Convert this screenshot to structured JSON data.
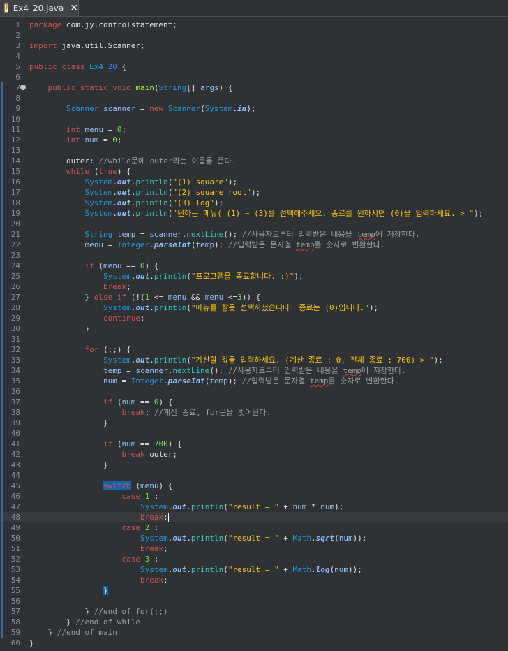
{
  "tab": {
    "filename": "Ex4_20.java",
    "close_glyph": "✕"
  },
  "lines": [
    {
      "n": 1,
      "t": [
        [
          "package",
          "kw"
        ],
        [
          " com.jy.controlstatement;",
          ""
        ]
      ]
    },
    {
      "n": 2,
      "t": []
    },
    {
      "n": 3,
      "t": [
        [
          "import",
          "kw"
        ],
        [
          " java.util.Scanner;",
          ""
        ]
      ]
    },
    {
      "n": 4,
      "t": []
    },
    {
      "n": 5,
      "t": [
        [
          "public",
          "kw"
        ],
        [
          " ",
          ""
        ],
        [
          "class",
          "kw"
        ],
        [
          " ",
          ""
        ],
        [
          "Ex4_20",
          "ty"
        ],
        [
          " {",
          ""
        ]
      ]
    },
    {
      "n": 6,
      "t": []
    },
    {
      "n": 7,
      "t": [
        [
          "    ",
          ""
        ],
        [
          "public",
          "kw"
        ],
        [
          " ",
          ""
        ],
        [
          "static",
          "kw"
        ],
        [
          " ",
          ""
        ],
        [
          "void",
          "kw"
        ],
        [
          " ",
          ""
        ],
        [
          "main",
          "fn"
        ],
        [
          "(",
          ""
        ],
        [
          "String",
          "ty"
        ],
        [
          "[] ",
          ""
        ],
        [
          "args",
          "sf"
        ],
        [
          ") {",
          ""
        ]
      ]
    },
    {
      "n": 8,
      "t": []
    },
    {
      "n": 9,
      "t": [
        [
          "        ",
          ""
        ],
        [
          "Scanner",
          "ty"
        ],
        [
          " ",
          ""
        ],
        [
          "scanner",
          "sf"
        ],
        [
          " = ",
          ""
        ],
        [
          "new",
          "kw"
        ],
        [
          " ",
          ""
        ],
        [
          "Scanner",
          "ty"
        ],
        [
          "(",
          ""
        ],
        [
          "System",
          "ty"
        ],
        [
          ".",
          ""
        ],
        [
          "in",
          "sm"
        ],
        [
          ");",
          ""
        ]
      ]
    },
    {
      "n": 10,
      "t": []
    },
    {
      "n": 11,
      "t": [
        [
          "        ",
          ""
        ],
        [
          "int",
          "kw"
        ],
        [
          " ",
          ""
        ],
        [
          "menu",
          "sf"
        ],
        [
          " = ",
          ""
        ],
        [
          "0",
          "nm"
        ],
        [
          ";",
          ""
        ]
      ]
    },
    {
      "n": 12,
      "t": [
        [
          "        ",
          ""
        ],
        [
          "int",
          "kw"
        ],
        [
          " ",
          ""
        ],
        [
          "num",
          "sf"
        ],
        [
          " = ",
          ""
        ],
        [
          "0",
          "nm"
        ],
        [
          ";",
          ""
        ]
      ]
    },
    {
      "n": 13,
      "t": []
    },
    {
      "n": 14,
      "t": [
        [
          "        outer: ",
          ""
        ],
        [
          "//while문에 outer라는 이름을 준다.",
          "cm"
        ]
      ]
    },
    {
      "n": 15,
      "t": [
        [
          "        ",
          ""
        ],
        [
          "while",
          "kw"
        ],
        [
          " (",
          ""
        ],
        [
          "true",
          "kw"
        ],
        [
          ") {",
          ""
        ]
      ]
    },
    {
      "n": 16,
      "t": [
        [
          "            ",
          ""
        ],
        [
          "System",
          "ty"
        ],
        [
          ".",
          ""
        ],
        [
          "out",
          "sm"
        ],
        [
          ".",
          ""
        ],
        [
          "println",
          "mc"
        ],
        [
          "(",
          ""
        ],
        [
          "\"(1) square\"",
          "st"
        ],
        [
          ");",
          ""
        ]
      ]
    },
    {
      "n": 17,
      "t": [
        [
          "            ",
          ""
        ],
        [
          "System",
          "ty"
        ],
        [
          ".",
          ""
        ],
        [
          "out",
          "sm"
        ],
        [
          ".",
          ""
        ],
        [
          "println",
          "mc"
        ],
        [
          "(",
          ""
        ],
        [
          "\"(2) square root\"",
          "st"
        ],
        [
          ");",
          ""
        ]
      ]
    },
    {
      "n": 18,
      "t": [
        [
          "            ",
          ""
        ],
        [
          "System",
          "ty"
        ],
        [
          ".",
          ""
        ],
        [
          "out",
          "sm"
        ],
        [
          ".",
          ""
        ],
        [
          "println",
          "mc"
        ],
        [
          "(",
          ""
        ],
        [
          "\"(3) log\"",
          "st"
        ],
        [
          ");",
          ""
        ]
      ]
    },
    {
      "n": 19,
      "t": [
        [
          "            ",
          ""
        ],
        [
          "System",
          "ty"
        ],
        [
          ".",
          ""
        ],
        [
          "out",
          "sm"
        ],
        [
          ".",
          ""
        ],
        [
          "println",
          "mc"
        ],
        [
          "(",
          ""
        ],
        [
          "\"원하는 메뉴( (1) ~ (3)를 선택해주세요. 종료를 원하시면 (0)을 입력하세요. > \"",
          "st"
        ],
        [
          ");",
          ""
        ]
      ]
    },
    {
      "n": 20,
      "t": []
    },
    {
      "n": 21,
      "t": [
        [
          "            ",
          ""
        ],
        [
          "String",
          "ty"
        ],
        [
          " ",
          ""
        ],
        [
          "temp",
          "sf"
        ],
        [
          " = ",
          ""
        ],
        [
          "scanner",
          "sf"
        ],
        [
          ".",
          ""
        ],
        [
          "nextLine",
          "mc"
        ],
        [
          "(); ",
          ""
        ],
        [
          "//사용자로부터 입력받은 내용을 ",
          "cm"
        ],
        [
          "temp",
          "cmt"
        ],
        [
          "에 저장한다.",
          "cm"
        ]
      ]
    },
    {
      "n": 22,
      "t": [
        [
          "            ",
          ""
        ],
        [
          "menu",
          "sf"
        ],
        [
          " = ",
          ""
        ],
        [
          "Integer",
          "ty"
        ],
        [
          ".",
          ""
        ],
        [
          "parseInt",
          "sm"
        ],
        [
          "(",
          ""
        ],
        [
          "temp",
          "sf"
        ],
        [
          "); ",
          ""
        ],
        [
          "//입력받은 문자열 ",
          "cm"
        ],
        [
          "temp",
          "cmt"
        ],
        [
          "를 숫자로 변환한다.",
          "cm"
        ]
      ]
    },
    {
      "n": 23,
      "t": []
    },
    {
      "n": 24,
      "t": [
        [
          "            ",
          ""
        ],
        [
          "if",
          "kw"
        ],
        [
          " (",
          ""
        ],
        [
          "menu",
          "sf"
        ],
        [
          " == ",
          ""
        ],
        [
          "0",
          "nm"
        ],
        [
          ") {",
          ""
        ]
      ]
    },
    {
      "n": 25,
      "t": [
        [
          "                ",
          ""
        ],
        [
          "System",
          "ty"
        ],
        [
          ".",
          ""
        ],
        [
          "out",
          "sm"
        ],
        [
          ".",
          ""
        ],
        [
          "println",
          "mc"
        ],
        [
          "(",
          ""
        ],
        [
          "\"프로그램을 종료합니다. :)\"",
          "st"
        ],
        [
          ");",
          ""
        ]
      ]
    },
    {
      "n": 26,
      "t": [
        [
          "                ",
          ""
        ],
        [
          "break",
          "kw"
        ],
        [
          ";",
          ""
        ]
      ]
    },
    {
      "n": 27,
      "t": [
        [
          "            } ",
          ""
        ],
        [
          "else",
          "kw"
        ],
        [
          " ",
          ""
        ],
        [
          "if",
          "kw"
        ],
        [
          " (!(",
          ""
        ],
        [
          "1",
          "nm"
        ],
        [
          " <= ",
          ""
        ],
        [
          "menu",
          "sf"
        ],
        [
          " && ",
          ""
        ],
        [
          "menu",
          "sf"
        ],
        [
          " <=",
          ""
        ],
        [
          "3",
          "nm"
        ],
        [
          ")) {",
          ""
        ]
      ]
    },
    {
      "n": 28,
      "t": [
        [
          "                ",
          ""
        ],
        [
          "System",
          "ty"
        ],
        [
          ".",
          ""
        ],
        [
          "out",
          "sm"
        ],
        [
          ".",
          ""
        ],
        [
          "println",
          "mc"
        ],
        [
          "(",
          ""
        ],
        [
          "\"메뉴를 잘못 선택하셨습니다! 종료는 (0)입니다.\"",
          "st"
        ],
        [
          ");",
          ""
        ]
      ]
    },
    {
      "n": 29,
      "t": [
        [
          "                ",
          ""
        ],
        [
          "continue",
          "kw"
        ],
        [
          ";",
          ""
        ]
      ]
    },
    {
      "n": 30,
      "t": [
        [
          "            }",
          ""
        ]
      ]
    },
    {
      "n": 31,
      "t": []
    },
    {
      "n": 32,
      "t": [
        [
          "            ",
          ""
        ],
        [
          "for",
          "kw"
        ],
        [
          " (;;) {",
          ""
        ]
      ]
    },
    {
      "n": 33,
      "t": [
        [
          "                ",
          ""
        ],
        [
          "System",
          "ty"
        ],
        [
          ".",
          ""
        ],
        [
          "out",
          "sm"
        ],
        [
          ".",
          ""
        ],
        [
          "println",
          "mc"
        ],
        [
          "(",
          ""
        ],
        [
          "\"계산할 값을 입력하세요. (계산 종료 : 0, 전체 종료 : 700) > \"",
          "st"
        ],
        [
          ");",
          ""
        ]
      ]
    },
    {
      "n": 34,
      "t": [
        [
          "                ",
          ""
        ],
        [
          "temp",
          "sf"
        ],
        [
          " = ",
          ""
        ],
        [
          "scanner",
          "sf"
        ],
        [
          ".",
          ""
        ],
        [
          "nextLine",
          "mc"
        ],
        [
          "(); ",
          ""
        ],
        [
          "//사용자로부터 입력받은 내용을 ",
          "cm"
        ],
        [
          "temp",
          "cmt"
        ],
        [
          "에 저장한다.",
          "cm"
        ]
      ]
    },
    {
      "n": 35,
      "t": [
        [
          "                ",
          ""
        ],
        [
          "num",
          "sf"
        ],
        [
          " = ",
          ""
        ],
        [
          "Integer",
          "ty"
        ],
        [
          ".",
          ""
        ],
        [
          "parseInt",
          "sm"
        ],
        [
          "(",
          ""
        ],
        [
          "temp",
          "sf"
        ],
        [
          "); ",
          ""
        ],
        [
          "//입력받은 문자열 ",
          "cm"
        ],
        [
          "temp",
          "cmt"
        ],
        [
          "를 숫자로 변환한다.",
          "cm"
        ]
      ]
    },
    {
      "n": 36,
      "t": []
    },
    {
      "n": 37,
      "t": [
        [
          "                ",
          ""
        ],
        [
          "if",
          "kw"
        ],
        [
          " (",
          ""
        ],
        [
          "num",
          "sf"
        ],
        [
          " == ",
          ""
        ],
        [
          "0",
          "nm"
        ],
        [
          ") {",
          ""
        ]
      ]
    },
    {
      "n": 38,
      "t": [
        [
          "                    ",
          ""
        ],
        [
          "break",
          "kw"
        ],
        [
          "; ",
          ""
        ],
        [
          "//계산 종료, for문을 벗어난다.",
          "cm"
        ]
      ]
    },
    {
      "n": 39,
      "t": [
        [
          "                }",
          ""
        ]
      ]
    },
    {
      "n": 40,
      "t": []
    },
    {
      "n": 41,
      "t": [
        [
          "                ",
          ""
        ],
        [
          "if",
          "kw"
        ],
        [
          " (",
          ""
        ],
        [
          "num",
          "sf"
        ],
        [
          " == ",
          ""
        ],
        [
          "700",
          "nm"
        ],
        [
          ") {",
          ""
        ]
      ]
    },
    {
      "n": 42,
      "t": [
        [
          "                    ",
          ""
        ],
        [
          "break",
          "kw"
        ],
        [
          " outer;",
          ""
        ]
      ]
    },
    {
      "n": 43,
      "t": [
        [
          "                }",
          ""
        ]
      ]
    },
    {
      "n": 44,
      "t": []
    },
    {
      "n": 45,
      "t": [
        [
          "                ",
          ""
        ],
        [
          "switch",
          "kw hl"
        ],
        [
          " (",
          ""
        ],
        [
          "menu",
          "sf"
        ],
        [
          ") {",
          ""
        ]
      ]
    },
    {
      "n": 46,
      "t": [
        [
          "                    ",
          ""
        ],
        [
          "case",
          "kw"
        ],
        [
          " ",
          ""
        ],
        [
          "1",
          "nm"
        ],
        [
          " :",
          ""
        ]
      ]
    },
    {
      "n": 47,
      "t": [
        [
          "                        ",
          ""
        ],
        [
          "System",
          "ty"
        ],
        [
          ".",
          ""
        ],
        [
          "out",
          "sm"
        ],
        [
          ".",
          ""
        ],
        [
          "println",
          "mc"
        ],
        [
          "(",
          ""
        ],
        [
          "\"result = \"",
          "st"
        ],
        [
          " + ",
          ""
        ],
        [
          "num",
          "sf"
        ],
        [
          " * ",
          ""
        ],
        [
          "num",
          "sf"
        ],
        [
          ");",
          ""
        ]
      ]
    },
    {
      "n": 48,
      "t": [
        [
          "                        ",
          ""
        ],
        [
          "break",
          "kw"
        ],
        [
          ";",
          ""
        ]
      ]
    },
    {
      "n": 49,
      "t": [
        [
          "                    ",
          ""
        ],
        [
          "case",
          "kw"
        ],
        [
          " ",
          ""
        ],
        [
          "2",
          "nm"
        ],
        [
          " :",
          ""
        ]
      ]
    },
    {
      "n": 50,
      "t": [
        [
          "                        ",
          ""
        ],
        [
          "System",
          "ty"
        ],
        [
          ".",
          ""
        ],
        [
          "out",
          "sm"
        ],
        [
          ".",
          ""
        ],
        [
          "println",
          "mc"
        ],
        [
          "(",
          ""
        ],
        [
          "\"result = \"",
          "st"
        ],
        [
          " + ",
          ""
        ],
        [
          "Math",
          "ty"
        ],
        [
          ".",
          ""
        ],
        [
          "sqrt",
          "sm"
        ],
        [
          "(",
          ""
        ],
        [
          "num",
          "sf"
        ],
        [
          "));",
          ""
        ]
      ]
    },
    {
      "n": 51,
      "t": [
        [
          "                        ",
          ""
        ],
        [
          "break",
          "kw"
        ],
        [
          ";",
          ""
        ]
      ]
    },
    {
      "n": 52,
      "t": [
        [
          "                    ",
          ""
        ],
        [
          "case",
          "kw"
        ],
        [
          " ",
          ""
        ],
        [
          "3",
          "nm"
        ],
        [
          " :",
          ""
        ]
      ]
    },
    {
      "n": 53,
      "t": [
        [
          "                        ",
          ""
        ],
        [
          "System",
          "ty"
        ],
        [
          ".",
          ""
        ],
        [
          "out",
          "sm"
        ],
        [
          ".",
          ""
        ],
        [
          "println",
          "mc"
        ],
        [
          "(",
          ""
        ],
        [
          "\"result = \"",
          "st"
        ],
        [
          " + ",
          ""
        ],
        [
          "Math",
          "ty"
        ],
        [
          ".",
          ""
        ],
        [
          "log",
          "sm"
        ],
        [
          "(",
          ""
        ],
        [
          "num",
          "sf"
        ],
        [
          "));",
          ""
        ]
      ]
    },
    {
      "n": 54,
      "t": [
        [
          "                        ",
          ""
        ],
        [
          "break",
          "kw"
        ],
        [
          ";",
          ""
        ]
      ]
    },
    {
      "n": 55,
      "t": [
        [
          "                ",
          ""
        ],
        [
          "}",
          "hl"
        ]
      ]
    },
    {
      "n": 56,
      "t": []
    },
    {
      "n": 57,
      "t": [
        [
          "            } ",
          ""
        ],
        [
          "//end of for(;;)",
          "cm"
        ]
      ]
    },
    {
      "n": 58,
      "t": [
        [
          "        } ",
          ""
        ],
        [
          "//end of while",
          "cm"
        ]
      ]
    },
    {
      "n": 59,
      "t": [
        [
          "    } ",
          ""
        ],
        [
          "//end of main",
          "cm"
        ]
      ]
    },
    {
      "n": 60,
      "t": [
        [
          "}",
          ""
        ]
      ]
    }
  ]
}
